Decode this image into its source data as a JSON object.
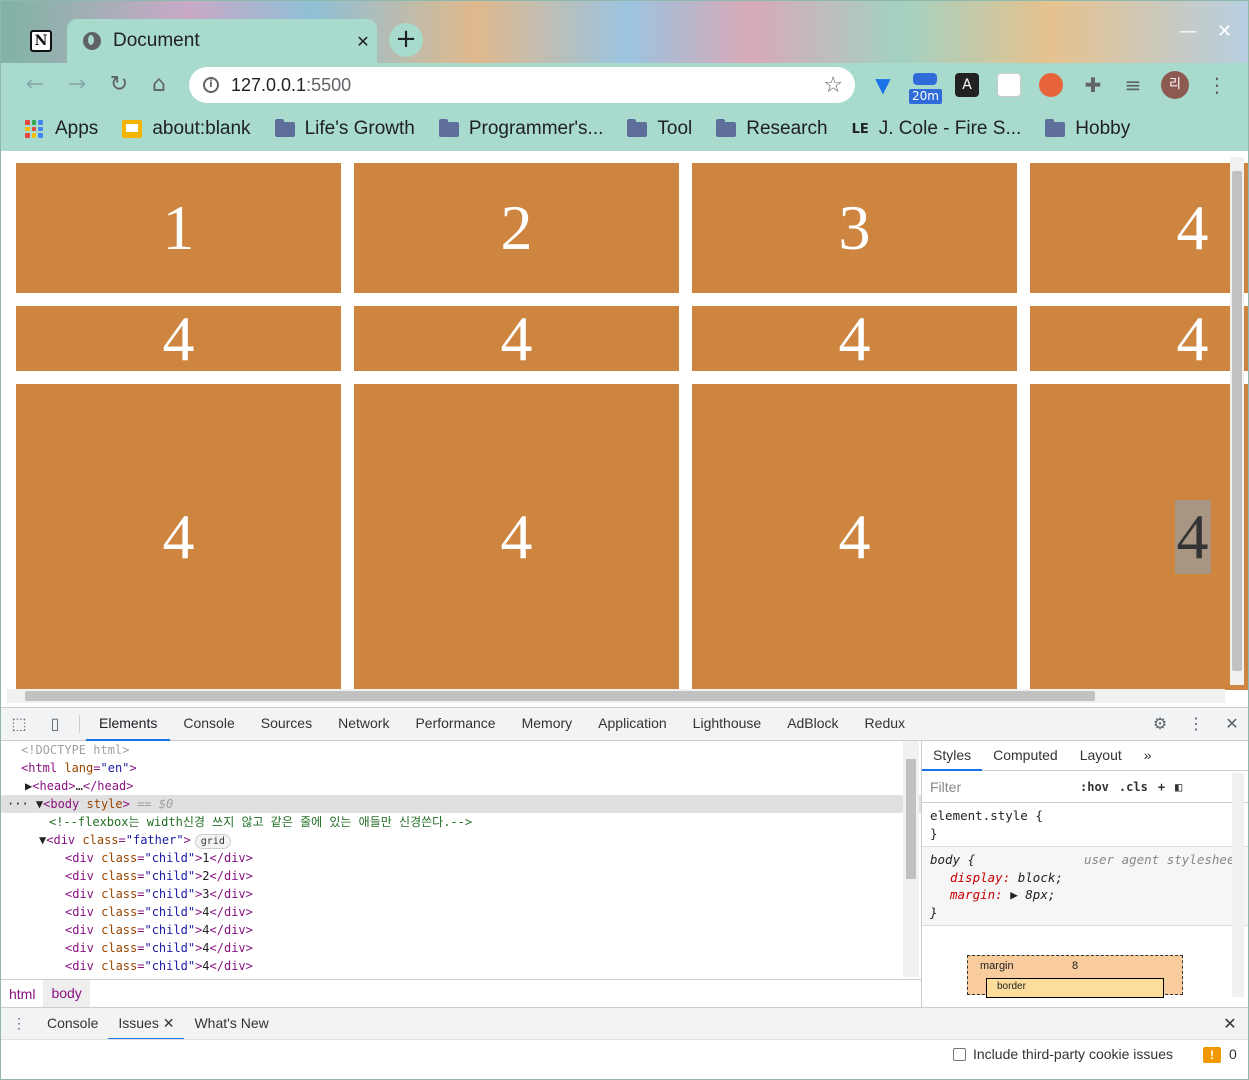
{
  "browser": {
    "tab_title": "Document",
    "tab_close": "✕",
    "new_tab": "+",
    "url_host": "127.0.0.1",
    "url_port": ":5500",
    "ext_badge": "20m",
    "avatar_text": "리",
    "window_minimize": "—",
    "window_close": "✕"
  },
  "bookmarks": [
    {
      "label": "Apps",
      "icon": "apps-grid-icon"
    },
    {
      "label": "about:blank",
      "icon": "page-icon"
    },
    {
      "label": "Life's Growth",
      "icon": "folder-icon"
    },
    {
      "label": "Programmer's...",
      "icon": "folder-icon"
    },
    {
      "label": "Tool",
      "icon": "folder-icon"
    },
    {
      "label": "Research",
      "icon": "folder-icon"
    },
    {
      "label": "J. Cole - Fire S...",
      "icon": "le-icon",
      "icon_text": "LE"
    },
    {
      "label": "Hobby",
      "icon": "folder-icon"
    }
  ],
  "page": {
    "children": [
      "1",
      "2",
      "3",
      "4",
      "4",
      "4",
      "4",
      "4",
      "4",
      "4",
      "4",
      "4"
    ],
    "colors": {
      "child_bg": "#cd853f",
      "child_text": "#ffffff"
    }
  },
  "devtools": {
    "tabs": [
      "Elements",
      "Console",
      "Sources",
      "Network",
      "Performance",
      "Memory",
      "Application",
      "Lighthouse",
      "AdBlock",
      "Redux"
    ],
    "active_tab": "Elements",
    "dom": {
      "doctype": "<!DOCTYPE html>",
      "html_open_tag": "<html",
      "lang_attr": "lang",
      "lang_val": "\"en\"",
      "head": "head",
      "head_ellipsis": "…",
      "body_tag": "body",
      "body_attr": "style",
      "body_marker": "== $0",
      "comment": "<!--flexbox는 width신경 쓰지 않고 같은 줄에 있는 애들만 신경쓴다.-->",
      "father_tag": "div",
      "class_attr": "class",
      "father_val": "\"father\"",
      "grid_badge": "grid",
      "child_val": "\"child\"",
      "child_texts": [
        "1",
        "2",
        "3",
        "4",
        "4",
        "4",
        "4"
      ]
    },
    "breadcrumbs": [
      "html",
      "body"
    ],
    "styles_tabs": [
      "Styles",
      "Computed",
      "Layout",
      "»"
    ],
    "filter_placeholder": "Filter",
    "hov": ":hov",
    "cls": ".cls",
    "element_style": "element.style {",
    "close_brace": "}",
    "body_rule": "body {",
    "ua_label": "user agent stylesheet",
    "props": [
      {
        "name": "display",
        "value": "block;"
      },
      {
        "name": "margin",
        "value": "▶ 8px;"
      }
    ],
    "boxmodel_label": "margin",
    "boxmodel_value": "8",
    "boxmodel_inner": "border",
    "drawer_tabs": [
      "Console",
      "Issues",
      "What's New"
    ],
    "drawer_active": "Issues",
    "cookie_label": "Include third-party cookie issues",
    "issues_count": "0"
  }
}
